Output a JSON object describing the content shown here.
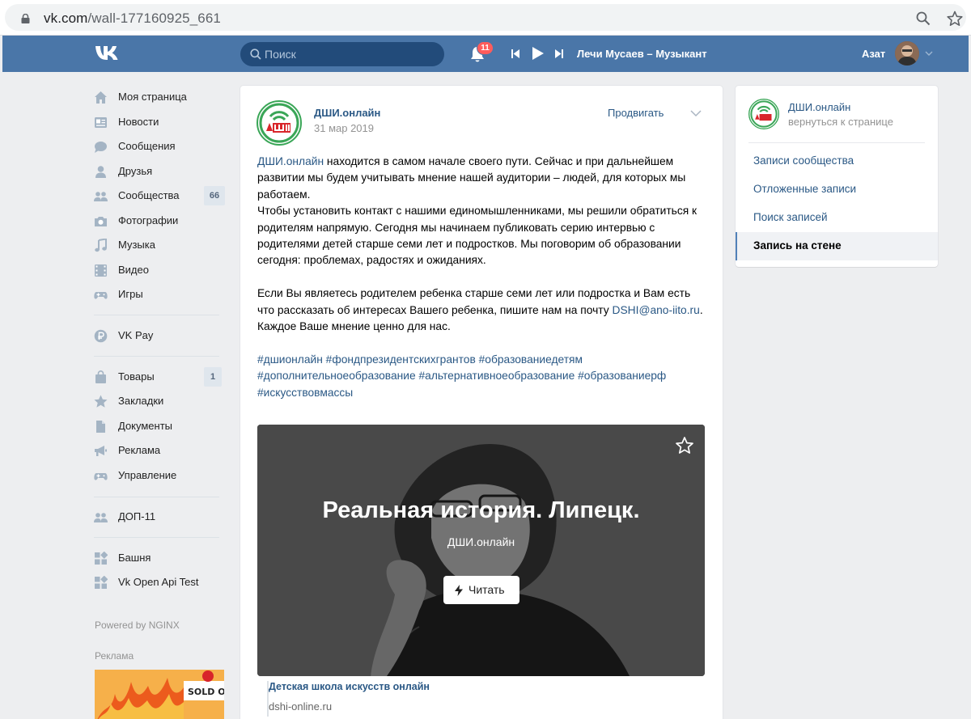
{
  "browser": {
    "url_host": "vk.com",
    "url_path": "/wall-177160925_661"
  },
  "header": {
    "search_placeholder": "Поиск",
    "notifications_count": "11",
    "now_playing": "Лечи Мусаев – Музыкант",
    "user_name": "Азат"
  },
  "sidebar": {
    "items": [
      {
        "label": "Моя страница",
        "icon": "home-icon"
      },
      {
        "label": "Новости",
        "icon": "news-icon"
      },
      {
        "label": "Сообщения",
        "icon": "messages-icon"
      },
      {
        "label": "Друзья",
        "icon": "friends-icon"
      },
      {
        "label": "Сообщества",
        "icon": "groups-icon",
        "count": "66"
      },
      {
        "label": "Фотографии",
        "icon": "camera-icon"
      },
      {
        "label": "Музыка",
        "icon": "music-icon"
      },
      {
        "label": "Видео",
        "icon": "video-icon"
      },
      {
        "label": "Игры",
        "icon": "gamepad-icon"
      },
      {
        "label": "VK Pay",
        "icon": "vkpay-icon"
      },
      {
        "label": "Товары",
        "icon": "bag-icon",
        "count": "1"
      },
      {
        "label": "Закладки",
        "icon": "bookmark-star-icon"
      },
      {
        "label": "Документы",
        "icon": "document-icon"
      },
      {
        "label": "Реклама",
        "icon": "megaphone-icon"
      },
      {
        "label": "Управление",
        "icon": "gamepad-icon"
      },
      {
        "label": "ДОП-11",
        "icon": "groups-icon"
      },
      {
        "label": "Башня",
        "icon": "app-icon"
      },
      {
        "label": "Vk Open Api Test",
        "icon": "app-icon"
      }
    ],
    "powered_by": "Powered by NGINX",
    "ads_title": "Реклама",
    "ad_text": "SOLD O"
  },
  "post": {
    "group_name": "ДШИ.онлайн",
    "date": "31 мар 2019",
    "promote_label": "Продвигать",
    "text": {
      "p1_link": "ДШИ.онлайн",
      "p1_rest": " находится в самом начале своего пути. Сейчас и при дальнейшем развитии мы будем учитывать мнение нашей аудитории – людей, для которых мы работаем.",
      "p2": "Чтобы установить контакт с нашими единомышленниками, мы решили обратиться к родителям напрямую. Сегодня мы начинаем публиковать серию интервью с родителями детей старше семи лет и подростков. Мы поговорим об образовании сегодня: проблемах, радостях и ожиданиях.",
      "p3_start": "Если Вы являетесь родителем ребенка старше семи лет или подростка и Вам есть что рассказать об интересах Вашего ребенка, пишите нам на почту ",
      "p3_email": "DSHI@ano-iito.ru",
      "p3_end": ".",
      "p4": "Каждое Ваше мнение ценно для нас.",
      "hashtags": "#дшионлайн #фондпрезидентскихгрантов #образованиедетям #дополнительноеобразование #альтернативноеобразование #образованиерф #искусствовмассы"
    },
    "article": {
      "title": "Реальная история. Липецк.",
      "source": "ДШИ.онлайн",
      "read_label": "Читать"
    },
    "snippet": {
      "title": "Детская школа искусств онлайн",
      "url": "dshi-online.ru"
    }
  },
  "right_panel": {
    "group_name": "ДШИ.онлайн",
    "back_label": "вернуться к странице",
    "items": [
      {
        "label": "Записи сообщества"
      },
      {
        "label": "Отложенные записи"
      },
      {
        "label": "Поиск записей"
      },
      {
        "label": "Запись на стене",
        "active": true
      }
    ]
  },
  "colors": {
    "header_bg": "#4a76a8",
    "link": "#2a5885",
    "page_bg": "#edeef0",
    "badge": "#ff5c5c"
  }
}
